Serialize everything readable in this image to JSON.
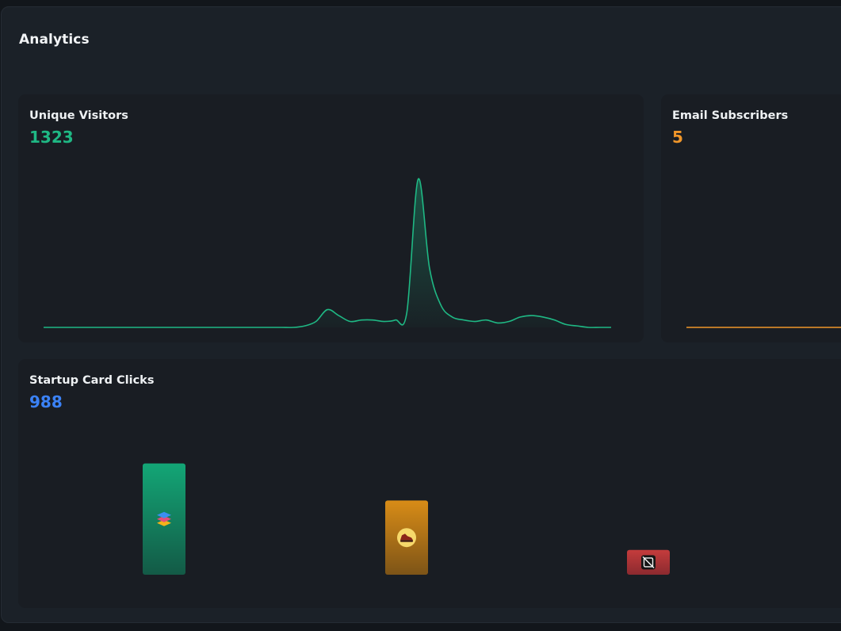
{
  "page": {
    "title": "Analytics"
  },
  "colors": {
    "visitors": "#1fb884",
    "subscribers": "#f0962a",
    "clicks": "#3b82f6",
    "bar_green": "#14a374",
    "bar_orange": "#d4881a",
    "bar_red": "#c23a3a"
  },
  "visitors": {
    "title": "Unique Visitors",
    "value": "1323"
  },
  "subscribers": {
    "title": "Email Subscribers",
    "value": "5"
  },
  "clicks": {
    "title": "Startup Card Clicks",
    "value": "988"
  },
  "chart_data": [
    {
      "type": "area",
      "series": [
        {
          "values": [
            0,
            0,
            0,
            0,
            0,
            0,
            0,
            0,
            0,
            0,
            0,
            0,
            0,
            0,
            0,
            0,
            0,
            0,
            0,
            0,
            0,
            0,
            0,
            1,
            4,
            12,
            8,
            4,
            5,
            5,
            4,
            5,
            10,
            100,
            40,
            15,
            7,
            5,
            4,
            5,
            3,
            4,
            7,
            8,
            7,
            5,
            2,
            1,
            0,
            0,
            0
          ]
        }
      ],
      "ylim": [
        0,
        100
      ],
      "grid": false,
      "legend": "none"
    },
    {
      "type": "line",
      "series": [
        {
          "values": [
            0,
            0,
            0,
            0,
            0,
            0,
            0,
            0
          ]
        }
      ],
      "grid": false,
      "legend": "none"
    },
    {
      "type": "bar",
      "categories": [
        "stack-icon",
        "sneaker-icon",
        "image-off-icon"
      ],
      "values": [
        45,
        30,
        10
      ],
      "ylim": [
        0,
        50
      ],
      "grid": false,
      "legend": "none"
    }
  ]
}
